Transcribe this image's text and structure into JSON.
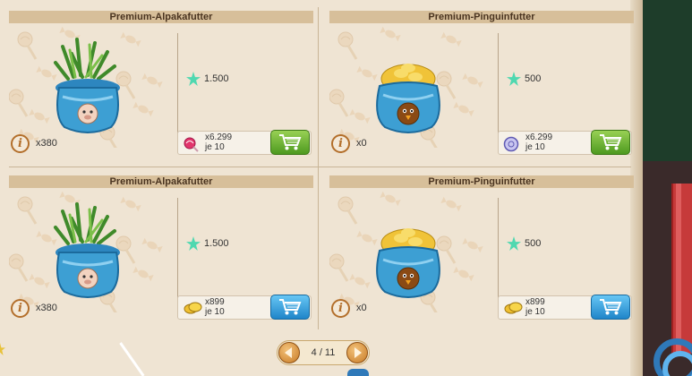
{
  "products": [
    {
      "title": "Premium-Alpakafutter",
      "kind": "alpaca",
      "price": "1.500",
      "owned": "x380",
      "cost_amount": "x6.299",
      "cost_unit": "je 10",
      "cost_currency": "lollipop-icon",
      "button_style": "green"
    },
    {
      "title": "Premium-Pinguinfutter",
      "kind": "penguin",
      "price": "500",
      "owned": "x0",
      "cost_amount": "x6.299",
      "cost_unit": "je 10",
      "cost_currency": "token-icon",
      "button_style": "green"
    },
    {
      "title": "Premium-Alpakafutter",
      "kind": "alpaca",
      "price": "1.500",
      "owned": "x380",
      "cost_amount": "x899",
      "cost_unit": "je 10",
      "cost_currency": "coins-icon",
      "button_style": "blue"
    },
    {
      "title": "Premium-Pinguinfutter",
      "kind": "penguin",
      "price": "500",
      "owned": "x0",
      "cost_amount": "x899",
      "cost_unit": "je 10",
      "cost_currency": "coins-icon",
      "button_style": "blue"
    }
  ],
  "pagination": {
    "label": "4 / 11"
  },
  "colors": {
    "title_bar": "#d7bf9a",
    "price_gem": "#4fd8b0",
    "cart_green": "#5ca92a",
    "cart_blue": "#1f85c9",
    "pot": "#3d9fd3"
  }
}
